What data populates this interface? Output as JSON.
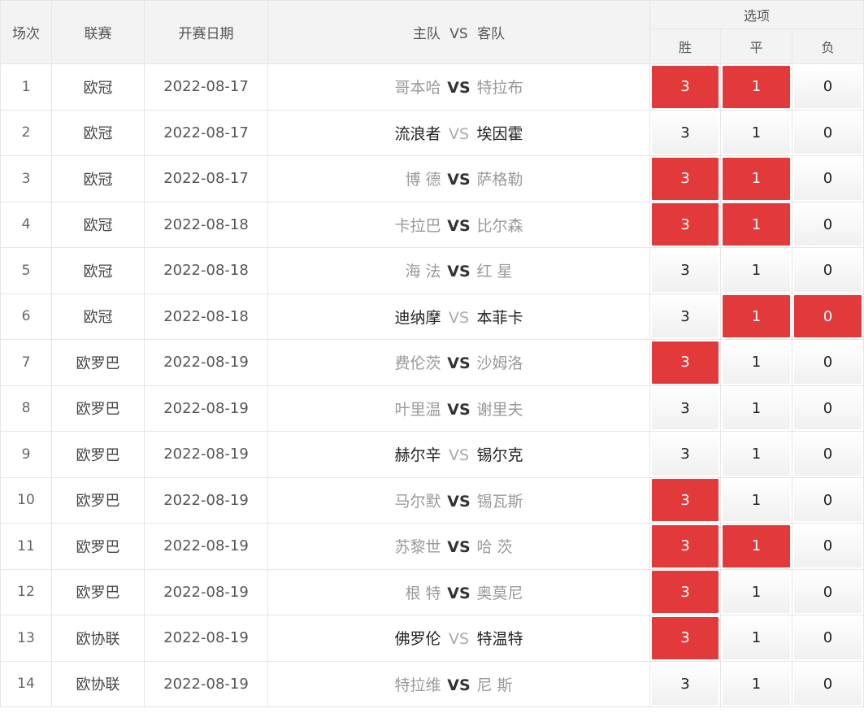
{
  "header": {
    "round": "场次",
    "league": "联赛",
    "date": "开赛日期",
    "match_home": "主队",
    "match_vs": "VS",
    "match_away": "客队",
    "options": "选项",
    "win": "胜",
    "draw": "平",
    "lose": "负"
  },
  "colors": {
    "selected": "#e23a3a",
    "header_bg": "#f3f3f3",
    "border": "#e6e6e6"
  },
  "rows": [
    {
      "no": "1",
      "league": "欧冠",
      "date": "2022-08-17",
      "home": "哥本哈",
      "vs": "VS",
      "away": "特拉布",
      "win": "3",
      "draw": "1",
      "lose": "0",
      "win_sel": true,
      "draw_sel": true,
      "lose_sel": false
    },
    {
      "no": "2",
      "league": "欧冠",
      "date": "2022-08-17",
      "home": "流浪者",
      "vs": "VS",
      "away": "埃因霍",
      "win": "3",
      "draw": "1",
      "lose": "0",
      "win_sel": false,
      "draw_sel": false,
      "lose_sel": false
    },
    {
      "no": "3",
      "league": "欧冠",
      "date": "2022-08-17",
      "home": "博 德",
      "vs": "VS",
      "away": "萨格勒",
      "win": "3",
      "draw": "1",
      "lose": "0",
      "win_sel": true,
      "draw_sel": true,
      "lose_sel": false
    },
    {
      "no": "4",
      "league": "欧冠",
      "date": "2022-08-18",
      "home": "卡拉巴",
      "vs": "VS",
      "away": "比尔森",
      "win": "3",
      "draw": "1",
      "lose": "0",
      "win_sel": true,
      "draw_sel": true,
      "lose_sel": false
    },
    {
      "no": "5",
      "league": "欧冠",
      "date": "2022-08-18",
      "home": "海 法",
      "vs": "VS",
      "away": "红 星",
      "win": "3",
      "draw": "1",
      "lose": "0",
      "win_sel": false,
      "draw_sel": false,
      "lose_sel": false
    },
    {
      "no": "6",
      "league": "欧冠",
      "date": "2022-08-18",
      "home": "迪纳摩",
      "vs": "VS",
      "away": "本菲卡",
      "win": "3",
      "draw": "1",
      "lose": "0",
      "win_sel": false,
      "draw_sel": true,
      "lose_sel": true
    },
    {
      "no": "7",
      "league": "欧罗巴",
      "date": "2022-08-19",
      "home": "费伦茨",
      "vs": "VS",
      "away": "沙姆洛",
      "win": "3",
      "draw": "1",
      "lose": "0",
      "win_sel": true,
      "draw_sel": false,
      "lose_sel": false
    },
    {
      "no": "8",
      "league": "欧罗巴",
      "date": "2022-08-19",
      "home": "叶里温",
      "vs": "VS",
      "away": "谢里夫",
      "win": "3",
      "draw": "1",
      "lose": "0",
      "win_sel": false,
      "draw_sel": false,
      "lose_sel": false
    },
    {
      "no": "9",
      "league": "欧罗巴",
      "date": "2022-08-19",
      "home": "赫尔辛",
      "vs": "VS",
      "away": "锡尔克",
      "win": "3",
      "draw": "1",
      "lose": "0",
      "win_sel": false,
      "draw_sel": false,
      "lose_sel": false
    },
    {
      "no": "10",
      "league": "欧罗巴",
      "date": "2022-08-19",
      "home": "马尔默",
      "vs": "VS",
      "away": "锡瓦斯",
      "win": "3",
      "draw": "1",
      "lose": "0",
      "win_sel": true,
      "draw_sel": false,
      "lose_sel": false
    },
    {
      "no": "11",
      "league": "欧罗巴",
      "date": "2022-08-19",
      "home": "苏黎世",
      "vs": "VS",
      "away": "哈 茨",
      "win": "3",
      "draw": "1",
      "lose": "0",
      "win_sel": true,
      "draw_sel": true,
      "lose_sel": false
    },
    {
      "no": "12",
      "league": "欧罗巴",
      "date": "2022-08-19",
      "home": "根 特",
      "vs": "VS",
      "away": "奥莫尼",
      "win": "3",
      "draw": "1",
      "lose": "0",
      "win_sel": true,
      "draw_sel": false,
      "lose_sel": false
    },
    {
      "no": "13",
      "league": "欧协联",
      "date": "2022-08-19",
      "home": "佛罗伦",
      "vs": "VS",
      "away": "特温特",
      "win": "3",
      "draw": "1",
      "lose": "0",
      "win_sel": true,
      "draw_sel": false,
      "lose_sel": false
    },
    {
      "no": "14",
      "league": "欧协联",
      "date": "2022-08-19",
      "home": "特拉维",
      "vs": "VS",
      "away": "尼 斯",
      "win": "3",
      "draw": "1",
      "lose": "0",
      "win_sel": false,
      "draw_sel": false,
      "lose_sel": false
    }
  ]
}
